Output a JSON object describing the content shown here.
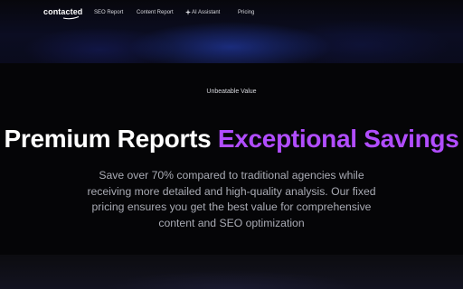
{
  "nav": {
    "logo": "contacted",
    "links": [
      "SEO Report",
      "Content Report",
      "AI Assistant",
      "Pricing"
    ]
  },
  "hero": {
    "eyebrow": "Unbeatable Value",
    "headline_white": "Premium Reports",
    "headline_accent": "Exceptional Savings",
    "subtext_lines": [
      "Save over 70% compared to traditional agencies while",
      "receiving more detailed and high-quality analysis. Our fixed",
      "pricing ensures you get the best value for comprehensive",
      "content and SEO optimization"
    ]
  },
  "colors": {
    "accent": "#b14dff",
    "background": "#050507",
    "text": "#ffffff",
    "muted_text": "#a9abb4"
  },
  "icons": {
    "ai_assistant": "sparkle-icon"
  }
}
